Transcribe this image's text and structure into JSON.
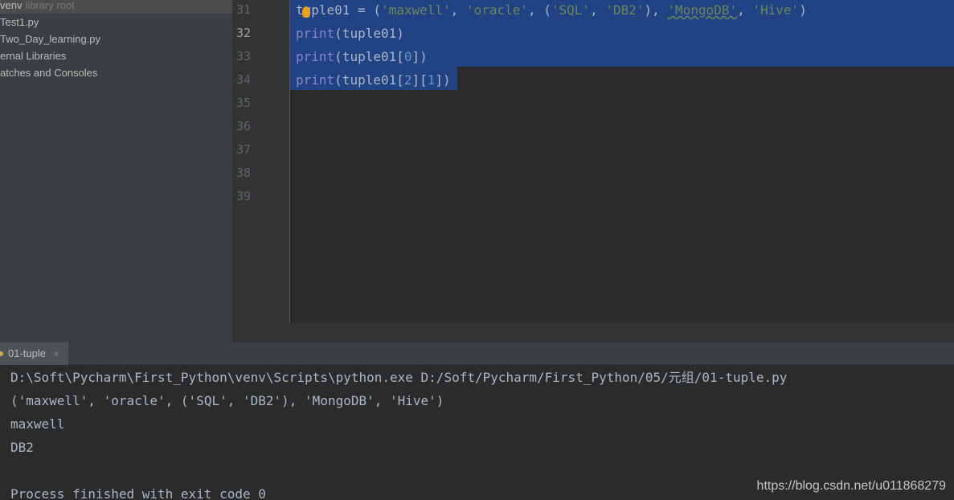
{
  "project_tree": {
    "items": [
      {
        "label": "venv",
        "hint": "library root"
      },
      {
        "label": "Test1.py"
      },
      {
        "label": "Two_Day_learning.py"
      },
      {
        "label": "ernal Libraries"
      },
      {
        "label": "atches and Consoles"
      }
    ]
  },
  "gutter": {
    "line_numbers": [
      "31",
      "32",
      "33",
      "34",
      "35",
      "36",
      "37",
      "38",
      "39"
    ],
    "current_line": "32"
  },
  "editor": {
    "line31": {
      "p1": "tuple01 = (",
      "s1": "'maxwell'",
      "c1": ", ",
      "s2": "'oracle'",
      "c2": ", (",
      "s3": "'SQL'",
      "c3": ", ",
      "s4": "'DB2'",
      "c4": "), ",
      "s5": "'MongoDB'",
      "c5": ", ",
      "s6": "'Hive'",
      "end": ")"
    },
    "line32": {
      "fn": "print",
      "rest": "(tuple01)"
    },
    "line33": {
      "fn": "print",
      "pre": "(tuple01[",
      "idx": "0",
      "post": "])"
    },
    "line34": {
      "fn": "print",
      "pre": "(tuple01[",
      "idx1": "2",
      "mid": "][",
      "idx2": "1",
      "post": "])"
    }
  },
  "run_panel": {
    "tab_label": "01-tuple",
    "close_glyph": "×",
    "output": [
      "D:\\Soft\\Pycharm\\First_Python\\venv\\Scripts\\python.exe D:/Soft/Pycharm/First_Python/05/元组/01-tuple.py",
      "('maxwell', 'oracle', ('SQL', 'DB2'), 'MongoDB', 'Hive')",
      "maxwell",
      "DB2",
      "",
      "Process finished with exit code 0"
    ]
  },
  "watermark": "https://blog.csdn.net/u011868279",
  "colors": {
    "selection": "#214283",
    "string": "#6a8759",
    "number": "#6897bb",
    "builtin": "#8888c6"
  },
  "icons": {
    "intention": "lightbulb-icon",
    "run_tab": "python-run-icon",
    "close": "close-icon"
  }
}
